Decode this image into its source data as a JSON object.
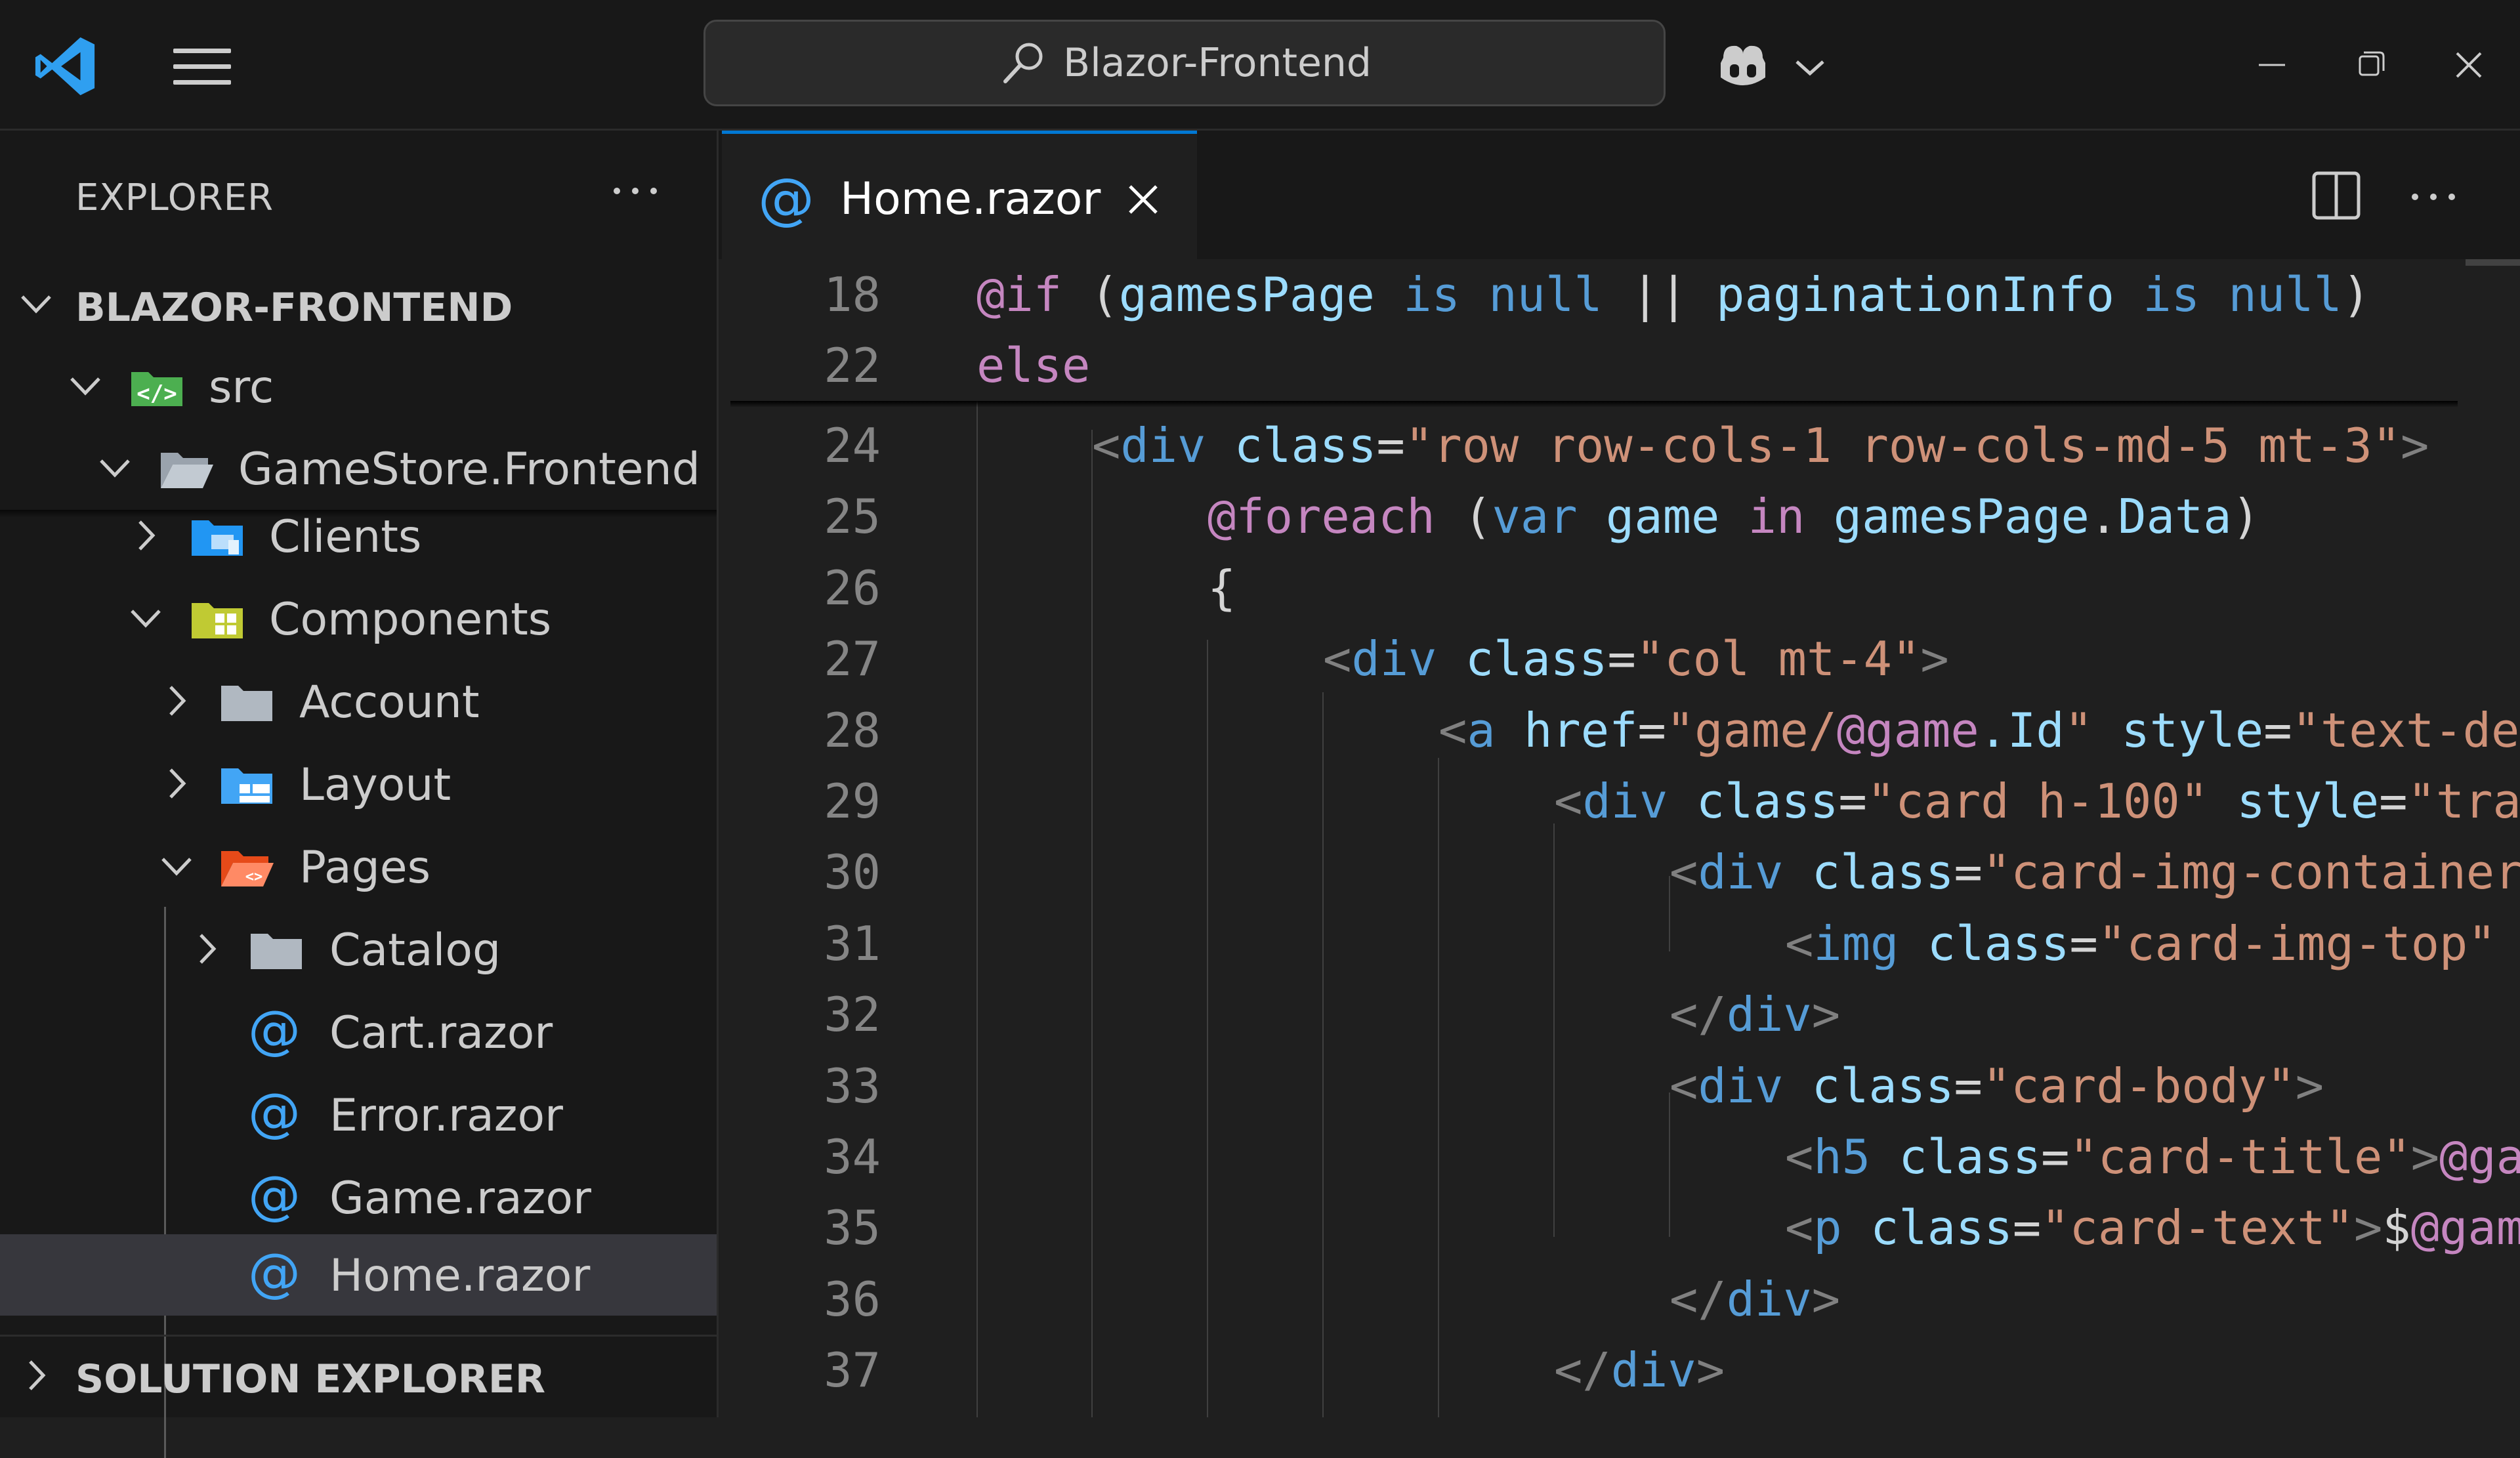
{
  "title_bar": {
    "search_text": "Blazor-Frontend"
  },
  "sidebar": {
    "title": "EXPLORER",
    "root": "BLAZOR-FRONTEND",
    "tree": [
      {
        "label": "src",
        "icon": "src-folder-icon"
      },
      {
        "label": "GameStore.Frontend",
        "icon": "folder-open-icon"
      },
      {
        "label": "Clients",
        "icon": "clients-folder-icon"
      },
      {
        "label": "Components",
        "icon": "components-folder-icon"
      },
      {
        "label": "Account",
        "icon": "folder-icon"
      },
      {
        "label": "Layout",
        "icon": "layout-folder-icon"
      },
      {
        "label": "Pages",
        "icon": "pages-folder-icon"
      },
      {
        "label": "Catalog",
        "icon": "folder-icon"
      },
      {
        "label": "Cart.razor",
        "icon": "razor-file-icon"
      },
      {
        "label": "Error.razor",
        "icon": "razor-file-icon"
      },
      {
        "label": "Game.razor",
        "icon": "razor-file-icon"
      },
      {
        "label": "Home.razor",
        "icon": "razor-file-icon",
        "selected": true
      }
    ],
    "solution_explorer": "SOLUTION EXPLORER"
  },
  "editor": {
    "tab_label": "Home.razor",
    "sticky_lines": [
      {
        "num": "18",
        "code": "@if (gamesPage is null || paginationInfo is null)"
      },
      {
        "num": "22",
        "code": "else"
      }
    ],
    "lines": [
      {
        "num": "24",
        "code": "    <div class=\"row row-cols-1 row-cols-md-5 mt-3\">"
      },
      {
        "num": "25",
        "code": "        @foreach (var game in gamesPage.Data)"
      },
      {
        "num": "26",
        "code": "        {"
      },
      {
        "num": "27",
        "code": "            <div class=\"col mt-4\">"
      },
      {
        "num": "28",
        "code": "                <a href=\"game/@game.Id\" style=\"text-de"
      },
      {
        "num": "29",
        "code": "                    <div class=\"card h-100\" style=\"tra"
      },
      {
        "num": "30",
        "code": "                        <div class=\"card-img-container"
      },
      {
        "num": "31",
        "code": "                            <img class=\"card-img-top\""
      },
      {
        "num": "32",
        "code": "                        </div>"
      },
      {
        "num": "33",
        "code": "                        <div class=\"card-body\">"
      },
      {
        "num": "34",
        "code": "                            <h5 class=\"card-title\">@ga"
      },
      {
        "num": "35",
        "code": "                            <p class=\"card-text\">$@gam"
      },
      {
        "num": "36",
        "code": "                        </div>"
      },
      {
        "num": "37",
        "code": "                    </div>"
      }
    ]
  },
  "colors": {
    "accent": "#0078d4",
    "keyword": "#c586c0",
    "builtin": "#569cd6",
    "variable": "#9cdcfe",
    "string": "#ce9178"
  }
}
